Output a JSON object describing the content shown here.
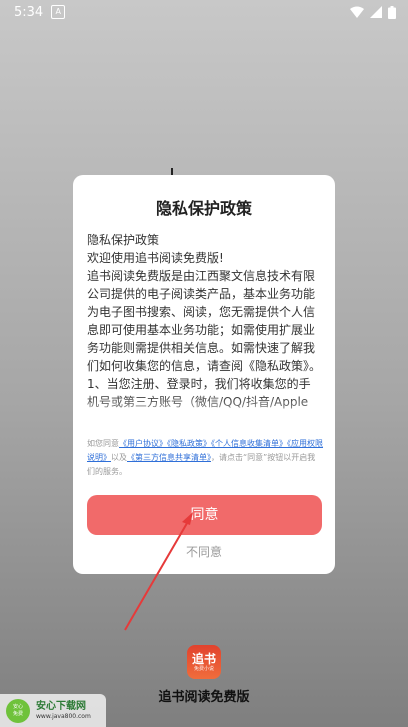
{
  "status_bar": {
    "time": "5:34",
    "badge": "A"
  },
  "dialog": {
    "title": "隐私保护政策",
    "body_lines": [
      "隐私保护政策",
      "欢迎使用追书阅读免费版!",
      "追书阅读免费版是由江西聚文信息技术有限公司提供的电子阅读类产品，基本业务功能为电子图书搜索、阅读，您无需提供个人信息即可使用基本业务功能；如需使用扩展业务功能则需提供相关信息。如需快速了解我们如何收集您的信息，请查阅《隐私政策》。",
      "1、当您注册、登录时，我们将收集您的手机号或第三方账号（微信/QQ/抖音/Apple"
    ],
    "agreement": {
      "prefix": "如您同意",
      "link_user": "《用户协议》",
      "link_privacy": "《隐私政策》",
      "link_collect": "《个人信息收集清单》",
      "link_permission": "《应用权限说明》",
      "and": "以及",
      "link_third": "《第三方信息共享清单》",
      "suffix": "，请点击“同意”按钮以开启我们的服务。"
    },
    "agree_label": "同意",
    "disagree_label": "不同意"
  },
  "app": {
    "logo_text": "追书",
    "logo_subtext": "免费小说",
    "name": "追书阅读免费版"
  },
  "watermark": {
    "logo_line1": "安心",
    "logo_line2": "免费",
    "title": "安心下载网",
    "url": "www.java800.com"
  },
  "colors": {
    "accent": "#f16a6a",
    "link": "#2f6fd8",
    "arrow": "#e63a3a"
  }
}
